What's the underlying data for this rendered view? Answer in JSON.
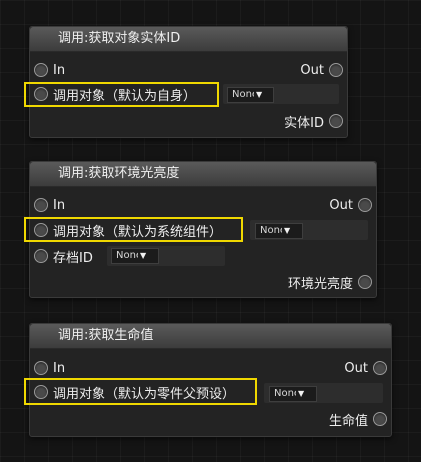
{
  "nodes": [
    {
      "title": "调用:获取对象实体ID",
      "in_label": "In",
      "out_label": "Out",
      "inputs": [
        {
          "label": "调用对象（默认为自身）",
          "dropdown": "None"
        }
      ],
      "output_label": "实体ID"
    },
    {
      "title": "调用:获取环境光亮度",
      "in_label": "In",
      "out_label": "Out",
      "inputs": [
        {
          "label": "调用对象（默认为系统组件）",
          "dropdown": "None"
        },
        {
          "label": "存档ID",
          "dropdown": "None"
        }
      ],
      "output_label": "环境光亮度"
    },
    {
      "title": "调用:获取生命值",
      "in_label": "In",
      "out_label": "Out",
      "inputs": [
        {
          "label": "调用对象（默认为零件父预设）",
          "dropdown": "None"
        }
      ],
      "output_label": "生命值"
    }
  ],
  "colors": {
    "highlight": "#f0d800",
    "background": "#141414",
    "node_body": "#232323",
    "node_header": "#4a4a4a"
  },
  "icons": {
    "pin": "circle-pin-icon",
    "dropdown": "caret-down-icon"
  }
}
